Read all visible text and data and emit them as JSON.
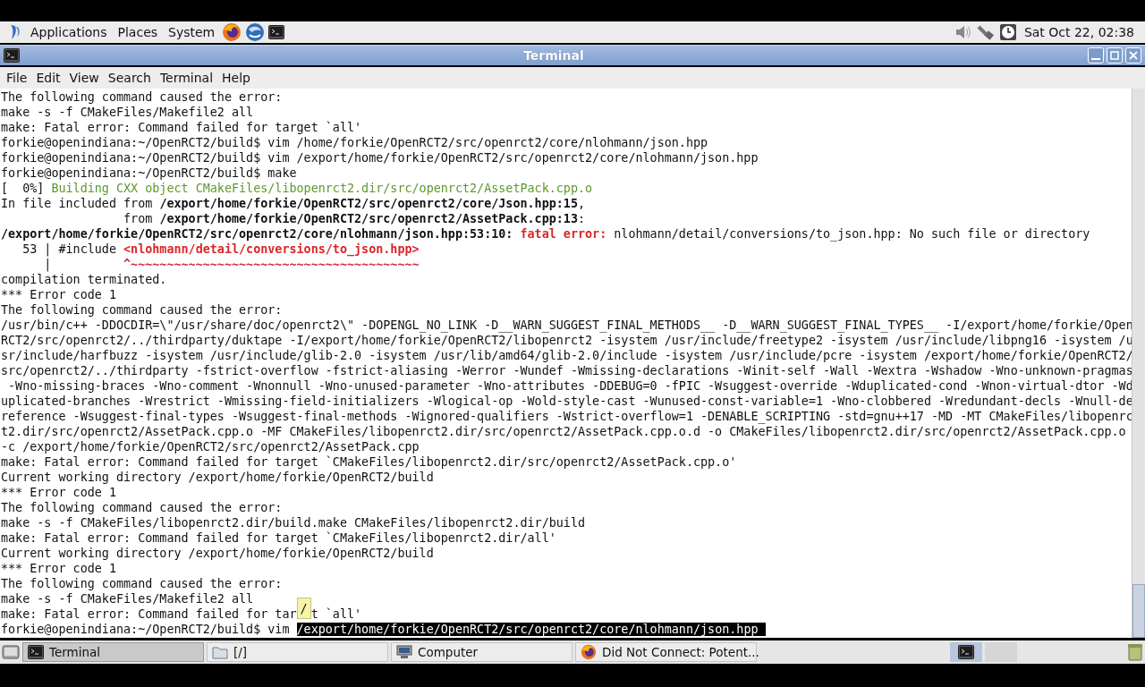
{
  "top_panel": {
    "menus": [
      "Applications",
      "Places",
      "System"
    ],
    "clock": "Sat Oct 22, 02:38"
  },
  "window": {
    "title": "Terminal"
  },
  "menu_bar": [
    "File",
    "Edit",
    "View",
    "Search",
    "Terminal",
    "Help"
  ],
  "terminal": {
    "lines": [
      [
        {
          "text": "The following command caused the error:",
          "kind": "plain"
        }
      ],
      [
        {
          "text": "make -s -f CMakeFiles/Makefile2 all",
          "kind": "plain"
        }
      ],
      [
        {
          "text": "make: Fatal error: Command failed for target `all'",
          "kind": "plain"
        }
      ],
      [
        {
          "text": "forkie@openindiana:~/OpenRCT2/build$ vim /home/forkie/OpenRCT2/src/openrct2/core/nlohmann/json.hpp",
          "kind": "plain"
        }
      ],
      [
        {
          "text": "forkie@openindiana:~/OpenRCT2/build$ vim /export/home/forkie/OpenRCT2/src/openrct2/core/nlohmann/json.hpp",
          "kind": "plain"
        }
      ],
      [
        {
          "text": "forkie@openindiana:~/OpenRCT2/build$ make",
          "kind": "plain"
        }
      ],
      [
        {
          "text": "[  0%] ",
          "kind": "plain"
        },
        {
          "text": "Building CXX object CMakeFiles/libopenrct2.dir/src/openrct2/AssetPack.cpp.o",
          "kind": "green"
        }
      ],
      [
        {
          "text": "In file included from ",
          "kind": "plain"
        },
        {
          "text": "/export/home/forkie/OpenRCT2/src/openrct2/core/Json.hpp:15",
          "kind": "bold"
        },
        {
          "text": ",",
          "kind": "plain"
        }
      ],
      [
        {
          "text": "                 from ",
          "kind": "plain"
        },
        {
          "text": "/export/home/forkie/OpenRCT2/src/openrct2/AssetPack.cpp:13",
          "kind": "bold"
        },
        {
          "text": ":",
          "kind": "plain"
        }
      ],
      [
        {
          "text": "/export/home/forkie/OpenRCT2/src/openrct2/core/nlohmann/json.hpp:53:10: ",
          "kind": "bold"
        },
        {
          "text": "fatal error:",
          "kind": "error_bold"
        },
        {
          "text": " nlohmann/detail/conversions/to_json.hpp: No such file or directory",
          "kind": "plain"
        }
      ],
      [
        {
          "text": "   53 | #include ",
          "kind": "plain"
        },
        {
          "text": "<nlohmann/detail/conversions/to_json.hpp>",
          "kind": "error_bold"
        }
      ],
      [
        {
          "text": "      |          ",
          "kind": "plain"
        },
        {
          "text": "^~~~~~~~~~~~~~~~~~~~~~~~~~~~~~~~~~~~~~~~~",
          "kind": "error_bold"
        }
      ],
      [
        {
          "text": "compilation terminated.",
          "kind": "plain"
        }
      ],
      [
        {
          "text": "*** Error code 1",
          "kind": "plain"
        }
      ],
      [
        {
          "text": "The following command caused the error:",
          "kind": "plain"
        }
      ],
      [
        {
          "text": "/usr/bin/c++ -DDOCDIR=\\\"/usr/share/doc/openrct2\\\" -DOPENGL_NO_LINK -D__WARN_SUGGEST_FINAL_METHODS__ -D__WARN_SUGGEST_FINAL_TYPES__ -I/export/home/forkie/Open",
          "kind": "plain"
        }
      ],
      [
        {
          "text": "RCT2/src/openrct2/../thirdparty/duktape -I/export/home/forkie/OpenRCT2/libopenrct2 -isystem /usr/include/freetype2 -isystem /usr/include/libpng16 -isystem /u",
          "kind": "plain"
        }
      ],
      [
        {
          "text": "sr/include/harfbuzz -isystem /usr/include/glib-2.0 -isystem /usr/lib/amd64/glib-2.0/include -isystem /usr/include/pcre -isystem /export/home/forkie/OpenRCT2/",
          "kind": "plain"
        }
      ],
      [
        {
          "text": "src/openrct2/../thirdparty -fstrict-overflow -fstrict-aliasing -Werror -Wundef -Wmissing-declarations -Winit-self -Wall -Wextra -Wshadow -Wno-unknown-pragmas",
          "kind": "plain"
        }
      ],
      [
        {
          "text": " -Wno-missing-braces -Wno-comment -Wnonnull -Wno-unused-parameter -Wno-attributes -DDEBUG=0 -fPIC -Wsuggest-override -Wduplicated-cond -Wnon-virtual-dtor -Wd",
          "kind": "plain"
        }
      ],
      [
        {
          "text": "uplicated-branches -Wrestrict -Wmissing-field-initializers -Wlogical-op -Wold-style-cast -Wunused-const-variable=1 -Wno-clobbered -Wredundant-decls -Wnull-de",
          "kind": "plain"
        }
      ],
      [
        {
          "text": "reference -Wsuggest-final-types -Wsuggest-final-methods -Wignored-qualifiers -Wstrict-overflow=1 -DENABLE_SCRIPTING -std=gnu++17 -MD -MT CMakeFiles/libopenrc",
          "kind": "plain"
        }
      ],
      [
        {
          "text": "t2.dir/src/openrct2/AssetPack.cpp.o -MF CMakeFiles/libopenrct2.dir/src/openrct2/AssetPack.cpp.o.d -o CMakeFiles/libopenrct2.dir/src/openrct2/AssetPack.cpp.o",
          "kind": "plain"
        }
      ],
      [
        {
          "text": "-c /export/home/forkie/OpenRCT2/src/openrct2/AssetPack.cpp",
          "kind": "plain"
        }
      ],
      [
        {
          "text": "make: Fatal error: Command failed for target `CMakeFiles/libopenrct2.dir/src/openrct2/AssetPack.cpp.o'",
          "kind": "plain"
        }
      ],
      [
        {
          "text": "Current working directory /export/home/forkie/OpenRCT2/build",
          "kind": "plain"
        }
      ],
      [
        {
          "text": "*** Error code 1",
          "kind": "plain"
        }
      ],
      [
        {
          "text": "The following command caused the error:",
          "kind": "plain"
        }
      ],
      [
        {
          "text": "make -s -f CMakeFiles/libopenrct2.dir/build.make CMakeFiles/libopenrct2.dir/build",
          "kind": "plain"
        }
      ],
      [
        {
          "text": "make: Fatal error: Command failed for target `CMakeFiles/libopenrct2.dir/all'",
          "kind": "plain"
        }
      ],
      [
        {
          "text": "Current working directory /export/home/forkie/OpenRCT2/build",
          "kind": "plain"
        }
      ],
      [
        {
          "text": "*** Error code 1",
          "kind": "plain"
        }
      ],
      [
        {
          "text": "The following command caused the error:",
          "kind": "plain"
        }
      ],
      [
        {
          "text": "make -s -f CMakeFiles/Makefile2 all",
          "kind": "plain"
        }
      ],
      [
        {
          "text": "make: Fatal error: Command failed for tar",
          "kind": "plain"
        },
        {
          "text": "/",
          "kind": "tooltip"
        },
        {
          "text": "t `all'",
          "kind": "plain"
        }
      ],
      [
        {
          "text": "forkie@openindiana:~/OpenRCT2/build$ vim ",
          "kind": "plain"
        },
        {
          "text": "/export/home/forkie/OpenRCT2/src/openrct2/core/nlohmann/json.hpp ",
          "kind": "selection"
        }
      ]
    ]
  },
  "taskbar": {
    "tasks": [
      {
        "label": "Terminal",
        "kind": "terminal",
        "selected": true
      },
      {
        "label": "[/]",
        "kind": "folder",
        "selected": false
      },
      {
        "label": "Computer",
        "kind": "computer",
        "selected": false
      },
      {
        "label": "Did Not Connect: Potent...",
        "kind": "browser",
        "selected": false
      }
    ]
  }
}
